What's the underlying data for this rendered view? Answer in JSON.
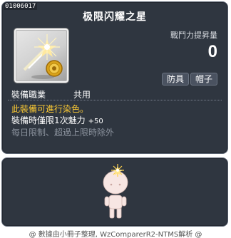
{
  "item": {
    "id": "01006017",
    "name": "极限闪耀之星",
    "icon": "shooting-star-coin-icon",
    "combat_power_label": "戰鬥力提昇量",
    "combat_power_value": "0",
    "tags": [
      "防具",
      "帽子"
    ],
    "job_label": "裝備職業",
    "job_value": "共用",
    "dye_text": "此裝備可進行染色。",
    "bonus_text": "裝備時僅限1次魅力",
    "bonus_value": "+50",
    "limit_text": "每日限制、超過上限時除外"
  },
  "preview": {
    "character": "chibi-character-with-star-hat"
  },
  "footer": {
    "text": "@ 數據由小冊子整理, WzComparerR2-NTMS解析 @"
  },
  "colors": {
    "panel_bg": "#2f3640",
    "dye_text": "#ffcc33",
    "limit_text": "#8a919c"
  }
}
